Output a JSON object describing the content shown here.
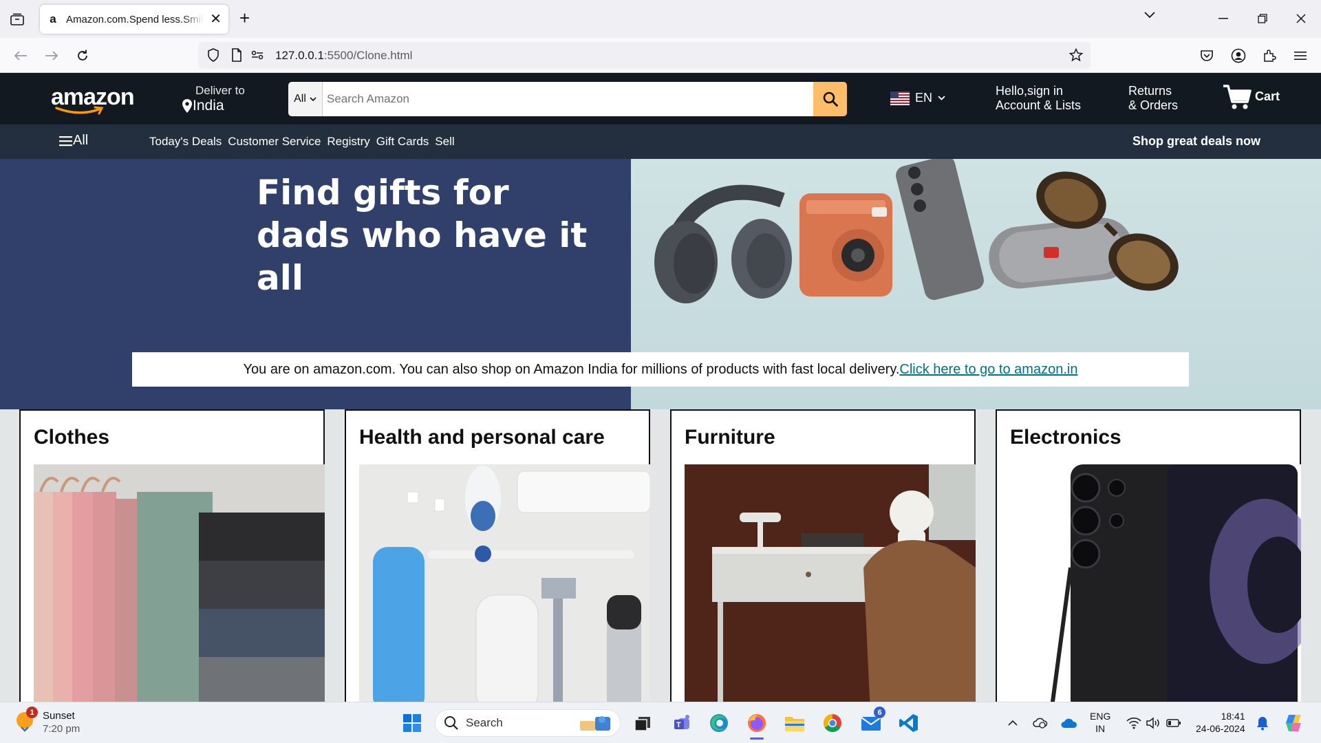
{
  "browser": {
    "tab_title": "Amazon.com.Spend less.Smile more.",
    "url_host": "127.0.0.1",
    "url_path": ":5500/Clone.html"
  },
  "header": {
    "logo": "amazon",
    "deliver_label": "Deliver to",
    "deliver_location": "India",
    "search_category": "All",
    "search_placeholder": "Search Amazon",
    "language": "EN",
    "greeting": "Hello,sign in",
    "account_label": "Account & Lists",
    "returns_label": "Returns",
    "orders_label": "& Orders",
    "cart_label": "Cart"
  },
  "subnav": {
    "all_label": "All",
    "links": [
      "Today's Deals",
      "Customer Service",
      "Registry",
      "Gift Cards",
      "Sell"
    ],
    "promo": "Shop great deals now"
  },
  "hero": {
    "title_line1": "Find gifts for",
    "title_line2": "dads who have it all",
    "notice_text": "You are on amazon.com. You can also shop on Amazon India for millions of products with fast local delivery.",
    "notice_link": "Click here to go to amazon.in"
  },
  "cards": [
    {
      "title": "Clothes"
    },
    {
      "title": "Health and personal care"
    },
    {
      "title": "Furniture"
    },
    {
      "title": "Electronics"
    }
  ],
  "taskbar": {
    "weather_title": "Sunset",
    "weather_time": "7:20 pm",
    "weather_badge": "1",
    "search_placeholder": "Search",
    "mail_badge": "6",
    "lang_top": "ENG",
    "lang_bottom": "IN",
    "clock_time": "18:41",
    "clock_date": "24-06-2024"
  },
  "colors": {
    "amazon_dark": "#131921",
    "amazon_nav": "#232f3e",
    "search_button": "#febd69",
    "hero_left": "#31406a",
    "link": "#007185"
  }
}
